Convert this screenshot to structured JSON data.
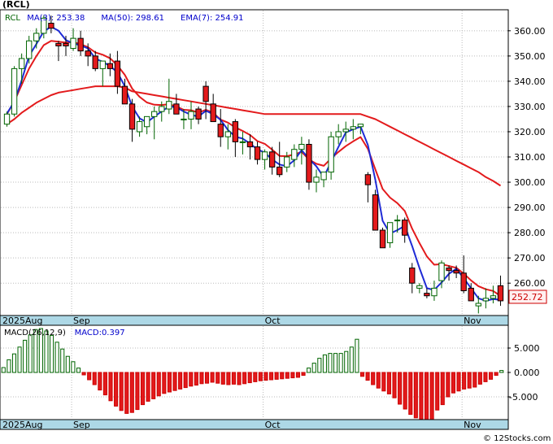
{
  "header": {
    "symbol": "(RCL)",
    "credit": "© 12Stocks.com"
  },
  "chart_data": [
    {
      "type": "candlestick",
      "legend": [
        {
          "label": "RCL",
          "color": "#006400"
        },
        {
          "label": "MA(3)",
          "value": "253.38",
          "color": "#0000cc"
        },
        {
          "label": "MA(50)",
          "value": "298.61",
          "color": "#0000cc"
        },
        {
          "label": "EMA(7)",
          "value": "254.91",
          "color": "#0000cc"
        }
      ],
      "ylim": [
        247.5,
        368
      ],
      "yticks": [
        "260.00",
        "270.00",
        "280.00",
        "290.00",
        "300.00",
        "310.00",
        "320.00",
        "330.00",
        "340.00",
        "350.00",
        "360.00"
      ],
      "last_price": "252.72",
      "x_labels": [
        "2025Aug",
        "Sep",
        "Oct",
        "Nov"
      ],
      "x_label_index": [
        0,
        9,
        35,
        62
      ],
      "candles": [
        [
          323,
          328,
          322,
          327
        ],
        [
          327,
          346,
          326,
          345
        ],
        [
          345,
          351,
          339,
          349
        ],
        [
          349,
          358,
          347,
          356
        ],
        [
          356,
          361,
          353,
          359
        ],
        [
          359,
          366,
          357,
          365
        ],
        [
          363,
          366,
          359,
          361
        ],
        [
          355,
          356,
          348,
          354
        ],
        [
          355,
          358,
          350,
          354
        ],
        [
          353,
          361,
          352,
          357
        ],
        [
          357,
          360,
          350,
          352
        ],
        [
          352,
          355,
          346,
          350
        ],
        [
          350,
          352,
          344,
          345
        ],
        [
          345,
          348,
          338,
          348
        ],
        [
          347,
          351,
          342,
          345
        ],
        [
          348,
          352,
          335,
          338
        ],
        [
          338,
          341,
          331,
          331
        ],
        [
          331,
          333,
          316,
          321
        ],
        [
          320,
          326,
          318,
          324
        ],
        [
          322,
          326,
          319,
          326
        ],
        [
          326,
          330,
          317,
          328
        ],
        [
          328,
          332,
          324,
          330
        ],
        [
          329,
          341,
          327,
          332
        ],
        [
          331,
          335,
          327,
          327
        ],
        [
          325,
          329,
          321,
          325
        ],
        [
          325,
          332,
          321,
          328
        ],
        [
          329,
          330,
          323,
          325
        ],
        [
          338,
          340,
          325,
          332
        ],
        [
          331,
          335,
          326,
          324
        ],
        [
          323,
          329,
          314,
          318
        ],
        [
          318,
          323,
          313,
          320
        ],
        [
          324,
          325,
          310,
          316
        ],
        [
          316,
          320,
          311,
          316
        ],
        [
          316,
          319,
          309,
          314
        ],
        [
          314,
          316,
          307,
          309
        ],
        [
          309,
          313,
          305,
          312
        ],
        [
          312,
          314,
          303,
          306
        ],
        [
          306,
          316,
          302,
          303
        ],
        [
          306,
          312,
          304,
          310
        ],
        [
          309,
          315,
          306,
          313
        ],
        [
          313,
          318,
          307,
          315
        ],
        [
          315,
          317,
          297,
          300
        ],
        [
          300,
          305,
          296,
          302
        ],
        [
          301,
          304,
          298,
          304
        ],
        [
          304,
          320,
          301,
          318
        ],
        [
          318,
          323,
          315,
          320
        ],
        [
          320,
          324,
          316,
          321
        ],
        [
          321,
          325,
          317,
          322
        ],
        [
          322,
          323,
          319,
          323
        ],
        [
          303,
          304,
          292,
          299
        ],
        [
          295,
          297,
          285,
          281
        ],
        [
          281,
          282,
          276,
          274
        ],
        [
          276,
          280,
          274,
          284
        ],
        [
          285,
          287,
          280,
          285
        ],
        [
          285,
          286,
          276,
          279
        ],
        [
          266,
          268,
          256,
          260
        ],
        [
          258,
          260,
          256,
          259
        ],
        [
          256,
          258,
          254,
          255
        ],
        [
          255,
          261,
          253,
          258
        ],
        [
          261,
          269,
          258,
          268
        ],
        [
          266,
          267,
          261,
          265
        ],
        [
          265,
          267,
          262,
          264
        ],
        [
          264,
          271,
          256,
          257
        ],
        [
          258,
          260,
          254,
          253
        ],
        [
          251,
          255,
          248,
          252
        ],
        [
          253,
          258,
          250,
          254
        ],
        [
          254,
          259,
          252,
          255
        ],
        [
          259,
          263,
          251,
          253
        ]
      ],
      "ma3": [
        327.2,
        331.9,
        340.3,
        350.0,
        354.8,
        359.8,
        361.6,
        360.0,
        356.3,
        355.0,
        354.2,
        353.0,
        349.0,
        347.7,
        346.0,
        343.5,
        338.0,
        330.0,
        325.3,
        323.7,
        326.0,
        328.0,
        330.0,
        329.7,
        328.0,
        326.7,
        326.0,
        328.3,
        327.0,
        324.7,
        320.7,
        318.0,
        317.3,
        315.3,
        313.0,
        311.7,
        309.0,
        307.0,
        306.3,
        308.7,
        312.7,
        309.3,
        306.3,
        302.0,
        308.0,
        314.0,
        319.7,
        321.0,
        322.0,
        314.7,
        301.0,
        284.7,
        279.7,
        281.0,
        282.7,
        274.7,
        266.0,
        258.0,
        257.3,
        260.3,
        263.7,
        265.7,
        262.0,
        258.0,
        254.0,
        253.0,
        253.7,
        253.4
      ],
      "ema7": [
        327.0,
        332.0,
        338.5,
        345.0,
        350.0,
        354.3,
        356.0,
        355.7,
        355.3,
        355.5,
        354.7,
        353.5,
        351.4,
        350.5,
        349.1,
        346.3,
        342.5,
        337.1,
        333.8,
        331.6,
        330.7,
        330.6,
        330.9,
        330.0,
        328.7,
        328.5,
        327.6,
        328.7,
        327.5,
        324.8,
        323.6,
        321.7,
        320.3,
        318.7,
        316.3,
        315.2,
        312.9,
        310.4,
        310.3,
        311.0,
        312.0,
        309.0,
        307.3,
        306.5,
        309.4,
        312.0,
        314.3,
        316.2,
        317.9,
        313.2,
        305.1,
        297.3,
        293.9,
        291.7,
        288.6,
        281.6,
        275.9,
        270.6,
        267.3,
        267.5,
        266.8,
        266.1,
        263.8,
        261.1,
        258.8,
        257.6,
        256.9,
        254.9
      ],
      "ma50": [
        323,
        325,
        327.5,
        329.5,
        331.5,
        333,
        334.5,
        335.5,
        336,
        336.5,
        337,
        337.5,
        338,
        338,
        338,
        338,
        337.5,
        336,
        335.5,
        335,
        334.5,
        334,
        333.5,
        333,
        332.5,
        332,
        331.5,
        331,
        330.5,
        330,
        329.5,
        329,
        328.5,
        328,
        327.5,
        327,
        327,
        327,
        327,
        327,
        327,
        327,
        327,
        327,
        327,
        327,
        327,
        327,
        327,
        326,
        325,
        323.5,
        322,
        320.5,
        319,
        317.5,
        316,
        314.5,
        313,
        311.5,
        310,
        308.5,
        307,
        305.5,
        304,
        302,
        300.5,
        298.6
      ]
    },
    {
      "type": "bar",
      "legend": [
        {
          "label": "MACD(26,12,9)",
          "color": "#000000"
        },
        {
          "label": "MACD:0.397",
          "color": "#0000cc"
        }
      ],
      "ylim": [
        -9.5,
        9.5
      ],
      "yticks": [
        "5.000",
        "0.000",
        "-5.000"
      ],
      "ytick_values": [
        5,
        0,
        -5
      ],
      "x_labels": [
        "2025Aug",
        "Sep",
        "Oct",
        "Nov"
      ],
      "x_label_index": [
        0,
        9,
        35,
        62
      ],
      "values": [
        1.0,
        2.6,
        3.8,
        5.2,
        6.6,
        7.7,
        8.8,
        9.0,
        8.5,
        7.6,
        6.2,
        4.8,
        3.3,
        2.2,
        0.9,
        -0.5,
        -1.5,
        -2.5,
        -3.6,
        -4.6,
        -5.8,
        -6.9,
        -7.8,
        -8.4,
        -8.2,
        -7.6,
        -6.6,
        -5.9,
        -5.4,
        -4.8,
        -4.3,
        -4.0,
        -3.7,
        -3.4,
        -3.1,
        -2.8,
        -2.6,
        -2.3,
        -2.2,
        -2.0,
        -2.2,
        -2.4,
        -2.5,
        -2.4,
        -2.5,
        -2.3,
        -2.1,
        -1.9,
        -1.7,
        -1.6,
        -1.5,
        -1.4,
        -1.3,
        -1.2,
        -1.1,
        -1.0,
        -0.6,
        0.9,
        1.9,
        2.9,
        3.6,
        3.9,
        3.9,
        3.9,
        4.3,
        5.2,
        6.8,
        -0.8,
        -1.6,
        -2.5,
        -3.2,
        -3.8,
        -4.4,
        -5.2,
        -6.5,
        -7.5,
        -8.6,
        -9.3,
        -9.6,
        -9.9,
        -9.7,
        -7.7,
        -6.6,
        -5.0,
        -4.2,
        -3.8,
        -3.4,
        -3.2,
        -3.0,
        -2.4,
        -1.9,
        -1.4,
        -0.6,
        0.4
      ]
    }
  ]
}
